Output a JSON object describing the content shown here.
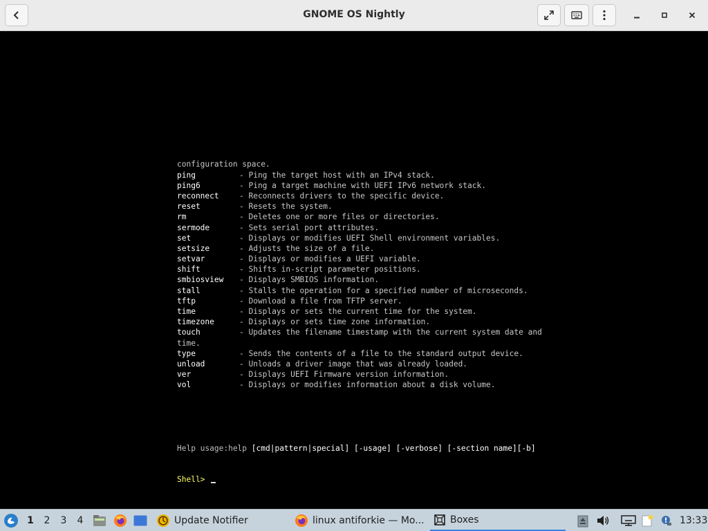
{
  "window": {
    "title": "GNOME OS Nightly"
  },
  "console": {
    "lines": [
      {
        "text": "configuration space."
      },
      {
        "cmd": "ping",
        "desc": "- Ping the target host with an IPv4 stack."
      },
      {
        "cmd": "ping6",
        "desc": "- Ping a target machine with UEFI IPv6 network stack."
      },
      {
        "cmd": "reconnect",
        "desc": "- Reconnects drivers to the specific device."
      },
      {
        "cmd": "reset",
        "desc": "- Resets the system."
      },
      {
        "cmd": "rm",
        "desc": "- Deletes one or more files or directories."
      },
      {
        "cmd": "sermode",
        "desc": "- Sets serial port attributes."
      },
      {
        "cmd": "set",
        "desc": "- Displays or modifies UEFI Shell environment variables."
      },
      {
        "cmd": "setsize",
        "desc": "- Adjusts the size of a file."
      },
      {
        "cmd": "setvar",
        "desc": "- Displays or modifies a UEFI variable."
      },
      {
        "cmd": "shift",
        "desc": "- Shifts in-script parameter positions."
      },
      {
        "cmd": "smbiosview",
        "desc": "- Displays SMBIOS information."
      },
      {
        "cmd": "stall",
        "desc": "- Stalls the operation for a specified number of microseconds."
      },
      {
        "cmd": "tftp",
        "desc": "- Download a file from TFTP server."
      },
      {
        "cmd": "time",
        "desc": "- Displays or sets the current time for the system."
      },
      {
        "cmd": "timezone",
        "desc": "- Displays or sets time zone information."
      },
      {
        "cmd": "touch",
        "desc": "- Updates the filename timestamp with the current system date and"
      },
      {
        "text": "time."
      },
      {
        "cmd": "type",
        "desc": "- Sends the contents of a file to the standard output device."
      },
      {
        "cmd": "unload",
        "desc": "- Unloads a driver image that was already loaded."
      },
      {
        "cmd": "ver",
        "desc": "- Displays UEFI Firmware version information."
      },
      {
        "cmd": "vol",
        "desc": "- Displays or modifies information about a disk volume."
      }
    ],
    "help_prefix": "Help usage:help ",
    "help_args": "[cmd|pattern|special] [-usage] [-verbose] [-section name][-b]",
    "prompt": "Shell> "
  },
  "taskbar": {
    "workspaces": [
      "1",
      "2",
      "3",
      "4"
    ],
    "active_workspace": "1",
    "tasks": [
      {
        "label": "Update Notifier",
        "icon": "update-notifier-icon"
      },
      {
        "label": "linux antiforkie — Mo...",
        "icon": "firefox-icon"
      },
      {
        "label": "Boxes",
        "icon": "boxes-icon"
      }
    ],
    "clock": "13:33"
  },
  "colors": {
    "header_bg": "#ebebeb",
    "taskbar_bg": "#c7d3dc",
    "console_bg": "#000000",
    "prompt_yellow": "#ffff66",
    "active_task_underline": "#3584e4"
  }
}
